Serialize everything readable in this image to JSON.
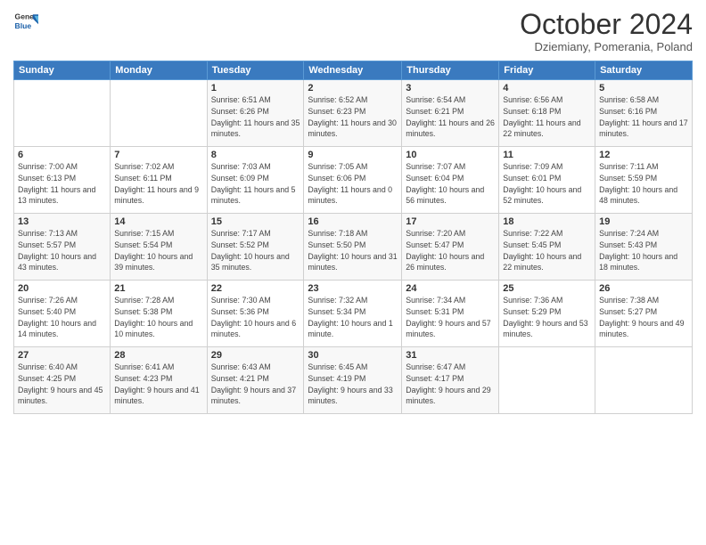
{
  "header": {
    "logo_general": "General",
    "logo_blue": "Blue",
    "month_title": "October 2024",
    "subtitle": "Dziemiany, Pomerania, Poland"
  },
  "weekdays": [
    "Sunday",
    "Monday",
    "Tuesday",
    "Wednesday",
    "Thursday",
    "Friday",
    "Saturday"
  ],
  "weeks": [
    [
      {
        "day": "",
        "info": ""
      },
      {
        "day": "",
        "info": ""
      },
      {
        "day": "1",
        "info": "Sunrise: 6:51 AM\nSunset: 6:26 PM\nDaylight: 11 hours and 35 minutes."
      },
      {
        "day": "2",
        "info": "Sunrise: 6:52 AM\nSunset: 6:23 PM\nDaylight: 11 hours and 30 minutes."
      },
      {
        "day": "3",
        "info": "Sunrise: 6:54 AM\nSunset: 6:21 PM\nDaylight: 11 hours and 26 minutes."
      },
      {
        "day": "4",
        "info": "Sunrise: 6:56 AM\nSunset: 6:18 PM\nDaylight: 11 hours and 22 minutes."
      },
      {
        "day": "5",
        "info": "Sunrise: 6:58 AM\nSunset: 6:16 PM\nDaylight: 11 hours and 17 minutes."
      }
    ],
    [
      {
        "day": "6",
        "info": "Sunrise: 7:00 AM\nSunset: 6:13 PM\nDaylight: 11 hours and 13 minutes."
      },
      {
        "day": "7",
        "info": "Sunrise: 7:02 AM\nSunset: 6:11 PM\nDaylight: 11 hours and 9 minutes."
      },
      {
        "day": "8",
        "info": "Sunrise: 7:03 AM\nSunset: 6:09 PM\nDaylight: 11 hours and 5 minutes."
      },
      {
        "day": "9",
        "info": "Sunrise: 7:05 AM\nSunset: 6:06 PM\nDaylight: 11 hours and 0 minutes."
      },
      {
        "day": "10",
        "info": "Sunrise: 7:07 AM\nSunset: 6:04 PM\nDaylight: 10 hours and 56 minutes."
      },
      {
        "day": "11",
        "info": "Sunrise: 7:09 AM\nSunset: 6:01 PM\nDaylight: 10 hours and 52 minutes."
      },
      {
        "day": "12",
        "info": "Sunrise: 7:11 AM\nSunset: 5:59 PM\nDaylight: 10 hours and 48 minutes."
      }
    ],
    [
      {
        "day": "13",
        "info": "Sunrise: 7:13 AM\nSunset: 5:57 PM\nDaylight: 10 hours and 43 minutes."
      },
      {
        "day": "14",
        "info": "Sunrise: 7:15 AM\nSunset: 5:54 PM\nDaylight: 10 hours and 39 minutes."
      },
      {
        "day": "15",
        "info": "Sunrise: 7:17 AM\nSunset: 5:52 PM\nDaylight: 10 hours and 35 minutes."
      },
      {
        "day": "16",
        "info": "Sunrise: 7:18 AM\nSunset: 5:50 PM\nDaylight: 10 hours and 31 minutes."
      },
      {
        "day": "17",
        "info": "Sunrise: 7:20 AM\nSunset: 5:47 PM\nDaylight: 10 hours and 26 minutes."
      },
      {
        "day": "18",
        "info": "Sunrise: 7:22 AM\nSunset: 5:45 PM\nDaylight: 10 hours and 22 minutes."
      },
      {
        "day": "19",
        "info": "Sunrise: 7:24 AM\nSunset: 5:43 PM\nDaylight: 10 hours and 18 minutes."
      }
    ],
    [
      {
        "day": "20",
        "info": "Sunrise: 7:26 AM\nSunset: 5:40 PM\nDaylight: 10 hours and 14 minutes."
      },
      {
        "day": "21",
        "info": "Sunrise: 7:28 AM\nSunset: 5:38 PM\nDaylight: 10 hours and 10 minutes."
      },
      {
        "day": "22",
        "info": "Sunrise: 7:30 AM\nSunset: 5:36 PM\nDaylight: 10 hours and 6 minutes."
      },
      {
        "day": "23",
        "info": "Sunrise: 7:32 AM\nSunset: 5:34 PM\nDaylight: 10 hours and 1 minute."
      },
      {
        "day": "24",
        "info": "Sunrise: 7:34 AM\nSunset: 5:31 PM\nDaylight: 9 hours and 57 minutes."
      },
      {
        "day": "25",
        "info": "Sunrise: 7:36 AM\nSunset: 5:29 PM\nDaylight: 9 hours and 53 minutes."
      },
      {
        "day": "26",
        "info": "Sunrise: 7:38 AM\nSunset: 5:27 PM\nDaylight: 9 hours and 49 minutes."
      }
    ],
    [
      {
        "day": "27",
        "info": "Sunrise: 6:40 AM\nSunset: 4:25 PM\nDaylight: 9 hours and 45 minutes."
      },
      {
        "day": "28",
        "info": "Sunrise: 6:41 AM\nSunset: 4:23 PM\nDaylight: 9 hours and 41 minutes."
      },
      {
        "day": "29",
        "info": "Sunrise: 6:43 AM\nSunset: 4:21 PM\nDaylight: 9 hours and 37 minutes."
      },
      {
        "day": "30",
        "info": "Sunrise: 6:45 AM\nSunset: 4:19 PM\nDaylight: 9 hours and 33 minutes."
      },
      {
        "day": "31",
        "info": "Sunrise: 6:47 AM\nSunset: 4:17 PM\nDaylight: 9 hours and 29 minutes."
      },
      {
        "day": "",
        "info": ""
      },
      {
        "day": "",
        "info": ""
      }
    ]
  ]
}
